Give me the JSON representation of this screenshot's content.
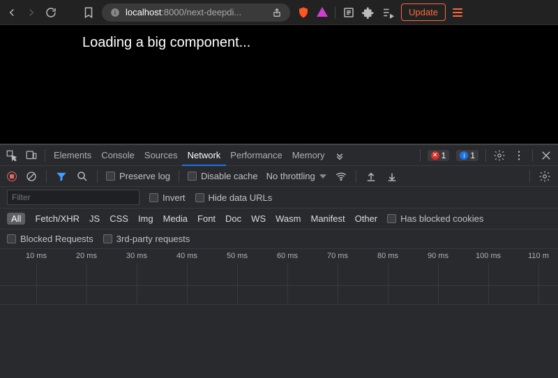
{
  "browser": {
    "url_host": "localhost",
    "url_port": ":8000",
    "url_path": "/next-deepdi...",
    "update_label": "Update"
  },
  "page": {
    "loading": "Loading a big component..."
  },
  "devtools": {
    "tabs": [
      "Elements",
      "Console",
      "Sources",
      "Network",
      "Performance",
      "Memory"
    ],
    "active_tab": "Network",
    "errors": "1",
    "messages": "1",
    "toolbar": {
      "preserve_log": "Preserve log",
      "disable_cache": "Disable cache",
      "throttling": "No throttling"
    },
    "filter": {
      "placeholder": "Filter",
      "invert": "Invert",
      "hide_data_urls": "Hide data URLs"
    },
    "types": [
      "All",
      "Fetch/XHR",
      "JS",
      "CSS",
      "Img",
      "Media",
      "Font",
      "Doc",
      "WS",
      "Wasm",
      "Manifest",
      "Other"
    ],
    "active_type": "All",
    "has_blocked_cookies": "Has blocked cookies",
    "blocked_requests": "Blocked Requests",
    "third_party": "3rd-party requests",
    "timeline_ticks": [
      "10 ms",
      "20 ms",
      "30 ms",
      "40 ms",
      "50 ms",
      "60 ms",
      "70 ms",
      "80 ms",
      "90 ms",
      "100 ms",
      "110 m"
    ]
  }
}
